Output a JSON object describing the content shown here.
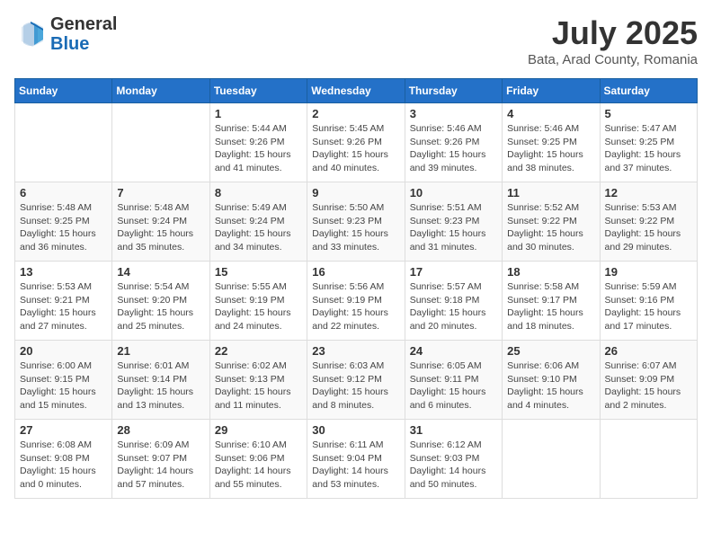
{
  "header": {
    "logo_line1": "General",
    "logo_line2": "Blue",
    "month_year": "July 2025",
    "location": "Bata, Arad County, Romania"
  },
  "weekdays": [
    "Sunday",
    "Monday",
    "Tuesday",
    "Wednesday",
    "Thursday",
    "Friday",
    "Saturday"
  ],
  "weeks": [
    [
      {
        "day": "",
        "info": ""
      },
      {
        "day": "",
        "info": ""
      },
      {
        "day": "1",
        "info": "Sunrise: 5:44 AM\nSunset: 9:26 PM\nDaylight: 15 hours and 41 minutes."
      },
      {
        "day": "2",
        "info": "Sunrise: 5:45 AM\nSunset: 9:26 PM\nDaylight: 15 hours and 40 minutes."
      },
      {
        "day": "3",
        "info": "Sunrise: 5:46 AM\nSunset: 9:26 PM\nDaylight: 15 hours and 39 minutes."
      },
      {
        "day": "4",
        "info": "Sunrise: 5:46 AM\nSunset: 9:25 PM\nDaylight: 15 hours and 38 minutes."
      },
      {
        "day": "5",
        "info": "Sunrise: 5:47 AM\nSunset: 9:25 PM\nDaylight: 15 hours and 37 minutes."
      }
    ],
    [
      {
        "day": "6",
        "info": "Sunrise: 5:48 AM\nSunset: 9:25 PM\nDaylight: 15 hours and 36 minutes."
      },
      {
        "day": "7",
        "info": "Sunrise: 5:48 AM\nSunset: 9:24 PM\nDaylight: 15 hours and 35 minutes."
      },
      {
        "day": "8",
        "info": "Sunrise: 5:49 AM\nSunset: 9:24 PM\nDaylight: 15 hours and 34 minutes."
      },
      {
        "day": "9",
        "info": "Sunrise: 5:50 AM\nSunset: 9:23 PM\nDaylight: 15 hours and 33 minutes."
      },
      {
        "day": "10",
        "info": "Sunrise: 5:51 AM\nSunset: 9:23 PM\nDaylight: 15 hours and 31 minutes."
      },
      {
        "day": "11",
        "info": "Sunrise: 5:52 AM\nSunset: 9:22 PM\nDaylight: 15 hours and 30 minutes."
      },
      {
        "day": "12",
        "info": "Sunrise: 5:53 AM\nSunset: 9:22 PM\nDaylight: 15 hours and 29 minutes."
      }
    ],
    [
      {
        "day": "13",
        "info": "Sunrise: 5:53 AM\nSunset: 9:21 PM\nDaylight: 15 hours and 27 minutes."
      },
      {
        "day": "14",
        "info": "Sunrise: 5:54 AM\nSunset: 9:20 PM\nDaylight: 15 hours and 25 minutes."
      },
      {
        "day": "15",
        "info": "Sunrise: 5:55 AM\nSunset: 9:19 PM\nDaylight: 15 hours and 24 minutes."
      },
      {
        "day": "16",
        "info": "Sunrise: 5:56 AM\nSunset: 9:19 PM\nDaylight: 15 hours and 22 minutes."
      },
      {
        "day": "17",
        "info": "Sunrise: 5:57 AM\nSunset: 9:18 PM\nDaylight: 15 hours and 20 minutes."
      },
      {
        "day": "18",
        "info": "Sunrise: 5:58 AM\nSunset: 9:17 PM\nDaylight: 15 hours and 18 minutes."
      },
      {
        "day": "19",
        "info": "Sunrise: 5:59 AM\nSunset: 9:16 PM\nDaylight: 15 hours and 17 minutes."
      }
    ],
    [
      {
        "day": "20",
        "info": "Sunrise: 6:00 AM\nSunset: 9:15 PM\nDaylight: 15 hours and 15 minutes."
      },
      {
        "day": "21",
        "info": "Sunrise: 6:01 AM\nSunset: 9:14 PM\nDaylight: 15 hours and 13 minutes."
      },
      {
        "day": "22",
        "info": "Sunrise: 6:02 AM\nSunset: 9:13 PM\nDaylight: 15 hours and 11 minutes."
      },
      {
        "day": "23",
        "info": "Sunrise: 6:03 AM\nSunset: 9:12 PM\nDaylight: 15 hours and 8 minutes."
      },
      {
        "day": "24",
        "info": "Sunrise: 6:05 AM\nSunset: 9:11 PM\nDaylight: 15 hours and 6 minutes."
      },
      {
        "day": "25",
        "info": "Sunrise: 6:06 AM\nSunset: 9:10 PM\nDaylight: 15 hours and 4 minutes."
      },
      {
        "day": "26",
        "info": "Sunrise: 6:07 AM\nSunset: 9:09 PM\nDaylight: 15 hours and 2 minutes."
      }
    ],
    [
      {
        "day": "27",
        "info": "Sunrise: 6:08 AM\nSunset: 9:08 PM\nDaylight: 15 hours and 0 minutes."
      },
      {
        "day": "28",
        "info": "Sunrise: 6:09 AM\nSunset: 9:07 PM\nDaylight: 14 hours and 57 minutes."
      },
      {
        "day": "29",
        "info": "Sunrise: 6:10 AM\nSunset: 9:06 PM\nDaylight: 14 hours and 55 minutes."
      },
      {
        "day": "30",
        "info": "Sunrise: 6:11 AM\nSunset: 9:04 PM\nDaylight: 14 hours and 53 minutes."
      },
      {
        "day": "31",
        "info": "Sunrise: 6:12 AM\nSunset: 9:03 PM\nDaylight: 14 hours and 50 minutes."
      },
      {
        "day": "",
        "info": ""
      },
      {
        "day": "",
        "info": ""
      }
    ]
  ]
}
